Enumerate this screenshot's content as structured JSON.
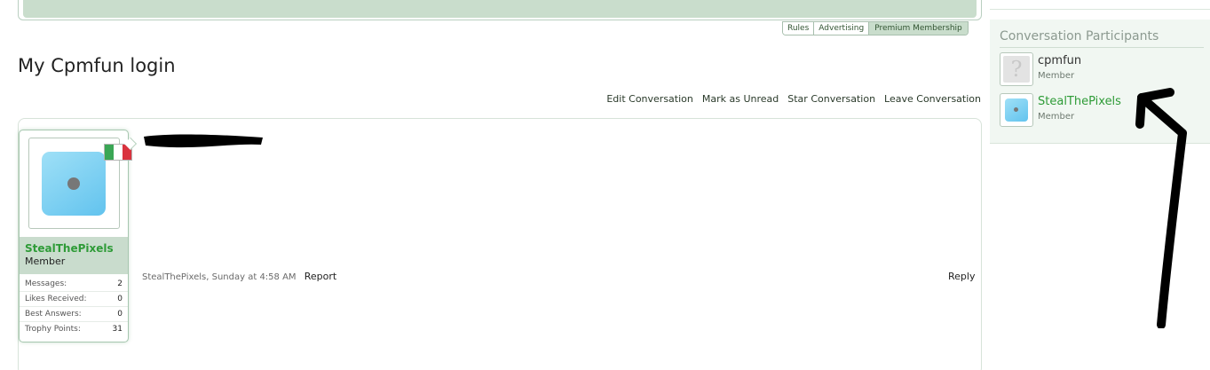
{
  "nav": {
    "tabs": [
      "Rules",
      "Advertising",
      "Premium Membership"
    ]
  },
  "page": {
    "title": "My Cpmfun login"
  },
  "conversation_actions": [
    "Edit Conversation",
    "Mark as Unread",
    "Star Conversation",
    "Leave Conversation"
  ],
  "message": {
    "author": "StealThePixels",
    "author_title": "Member",
    "timestamp": "StealThePixels, Sunday at 4:58 AM",
    "report_label": "Report",
    "reply_label": "Reply",
    "flag_colors": [
      "#3aa655",
      "#ffffff",
      "#d9333f"
    ],
    "stats": [
      {
        "label": "Messages:",
        "value": "2"
      },
      {
        "label": "Likes Received:",
        "value": "0"
      },
      {
        "label": "Best Answers:",
        "value": "0"
      },
      {
        "label": "Trophy Points:",
        "value": "31"
      }
    ]
  },
  "sidebar": {
    "heading": "Conversation Participants",
    "participants": [
      {
        "name": "cpmfun",
        "role": "Member",
        "avatar": "default-avatar-icon",
        "name_color": "#333333"
      },
      {
        "name": "StealThePixels",
        "role": "Member",
        "avatar": "blue-square-avatar",
        "name_color": "#2e9b37"
      }
    ]
  },
  "colors": {
    "accent_green": "#2e9b37",
    "banner_green": "#c9ddcc",
    "annotation": "#000000"
  }
}
